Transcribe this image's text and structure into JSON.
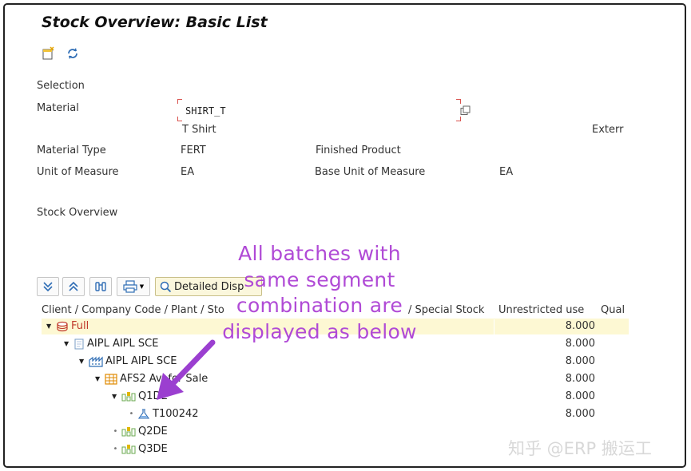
{
  "title": "Stock Overview: Basic List",
  "toolbar": {
    "icons": [
      "new-folder-icon",
      "refresh-icon"
    ]
  },
  "selection": {
    "heading": "Selection",
    "material_label": "Material",
    "material_value": "SHIRT_T",
    "material_desc": "T Shirt",
    "material_extra": "Exterr",
    "material_type_label": "Material Type",
    "material_type_value": "FERT",
    "material_type_desc": "Finished Product",
    "uom_label": "Unit of Measure",
    "uom_value": "EA",
    "base_uom_label": "Base Unit of Measure",
    "base_uom_value": "EA"
  },
  "stock_overview": {
    "heading": "Stock Overview",
    "buttons": {
      "detailed_label": "Detailed Disp"
    },
    "columns": {
      "hierarchy": "Client / Company Code / Plant / Sto",
      "special": "/ Special Stock",
      "unrestricted": "Unrestricted use",
      "quality": "Qual"
    },
    "rows": [
      {
        "label": "Full",
        "qty": "8.000",
        "icon": "database-icon",
        "level": 0,
        "expanded": true
      },
      {
        "label": "AIPL AIPL SCE",
        "qty": "8.000",
        "icon": "company-code-icon",
        "level": 1,
        "expanded": true
      },
      {
        "label": "AIPL AIPL SCE",
        "qty": "8.000",
        "icon": "plant-icon",
        "level": 2,
        "expanded": true
      },
      {
        "label": "AFS2 Avl for Sale",
        "qty": "8.000",
        "icon": "storage-location-icon",
        "level": 3,
        "expanded": true
      },
      {
        "label": "Q1DE",
        "qty": "8.000",
        "icon": "segment-icon",
        "level": 4,
        "expanded": true
      },
      {
        "label": "T100242",
        "qty": "8.000",
        "icon": "batch-icon",
        "level": 5,
        "expanded": false
      },
      {
        "label": "Q2DE",
        "qty": "",
        "icon": "segment-icon",
        "level": 4,
        "expanded": false
      },
      {
        "label": "Q3DE",
        "qty": "",
        "icon": "segment-icon",
        "level": 4,
        "expanded": false
      }
    ]
  },
  "annotation": {
    "lines": [
      "All batches with",
      "same segment",
      "combination are",
      "displayed as below"
    ],
    "color": "#b04ad6"
  },
  "watermark": "知乎 @ERP 搬运工"
}
